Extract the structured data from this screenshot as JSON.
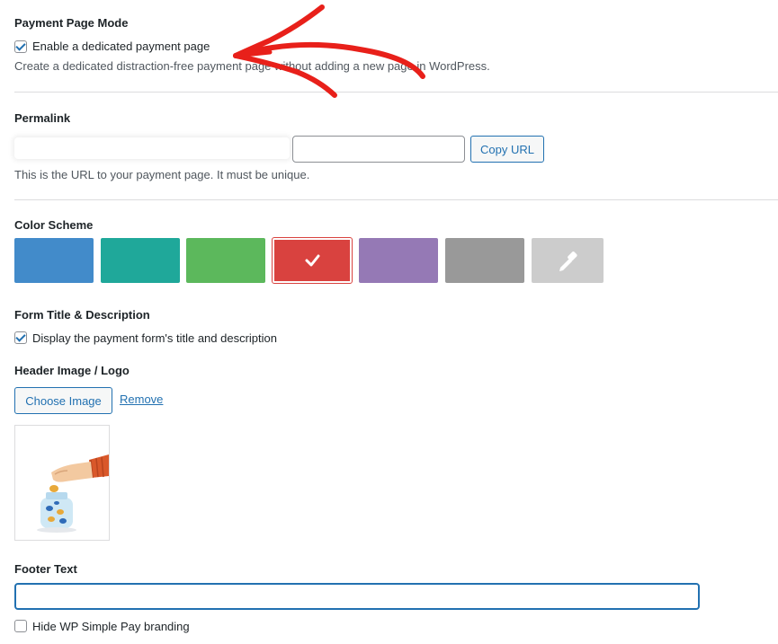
{
  "payment_mode": {
    "heading": "Payment Page Mode",
    "checkbox_label": "Enable a dedicated payment page",
    "checkbox_checked": true,
    "description": "Create a dedicated distraction-free payment page without adding a new page in WordPress."
  },
  "permalink": {
    "heading": "Permalink",
    "base_url": "",
    "slug_value": "",
    "copy_button": "Copy URL",
    "description": "This is the URL to your payment page. It must be unique."
  },
  "color_scheme": {
    "heading": "Color Scheme",
    "swatches": [
      {
        "color": "#428bca",
        "selected": false
      },
      {
        "color": "#1fa89a",
        "selected": false
      },
      {
        "color": "#5cb85c",
        "selected": false
      },
      {
        "color": "#d9423f",
        "selected": true
      },
      {
        "color": "#9579b5",
        "selected": false
      },
      {
        "color": "#999999",
        "selected": false
      },
      {
        "color": "#cccccc",
        "selected": false,
        "icon": "eyedropper-icon"
      }
    ]
  },
  "form_title": {
    "heading": "Form Title & Description",
    "checkbox_label": "Display the payment form's title and description",
    "checkbox_checked": true
  },
  "header_image": {
    "heading": "Header Image / Logo",
    "choose_button": "Choose Image",
    "remove_link": "Remove"
  },
  "footer": {
    "heading": "Footer Text",
    "input_value": "",
    "checkbox_label": "Hide WP Simple Pay branding",
    "checkbox_checked": false
  },
  "colors": {
    "accent": "#2271b1",
    "annotation_arrow": "#e8201a"
  }
}
